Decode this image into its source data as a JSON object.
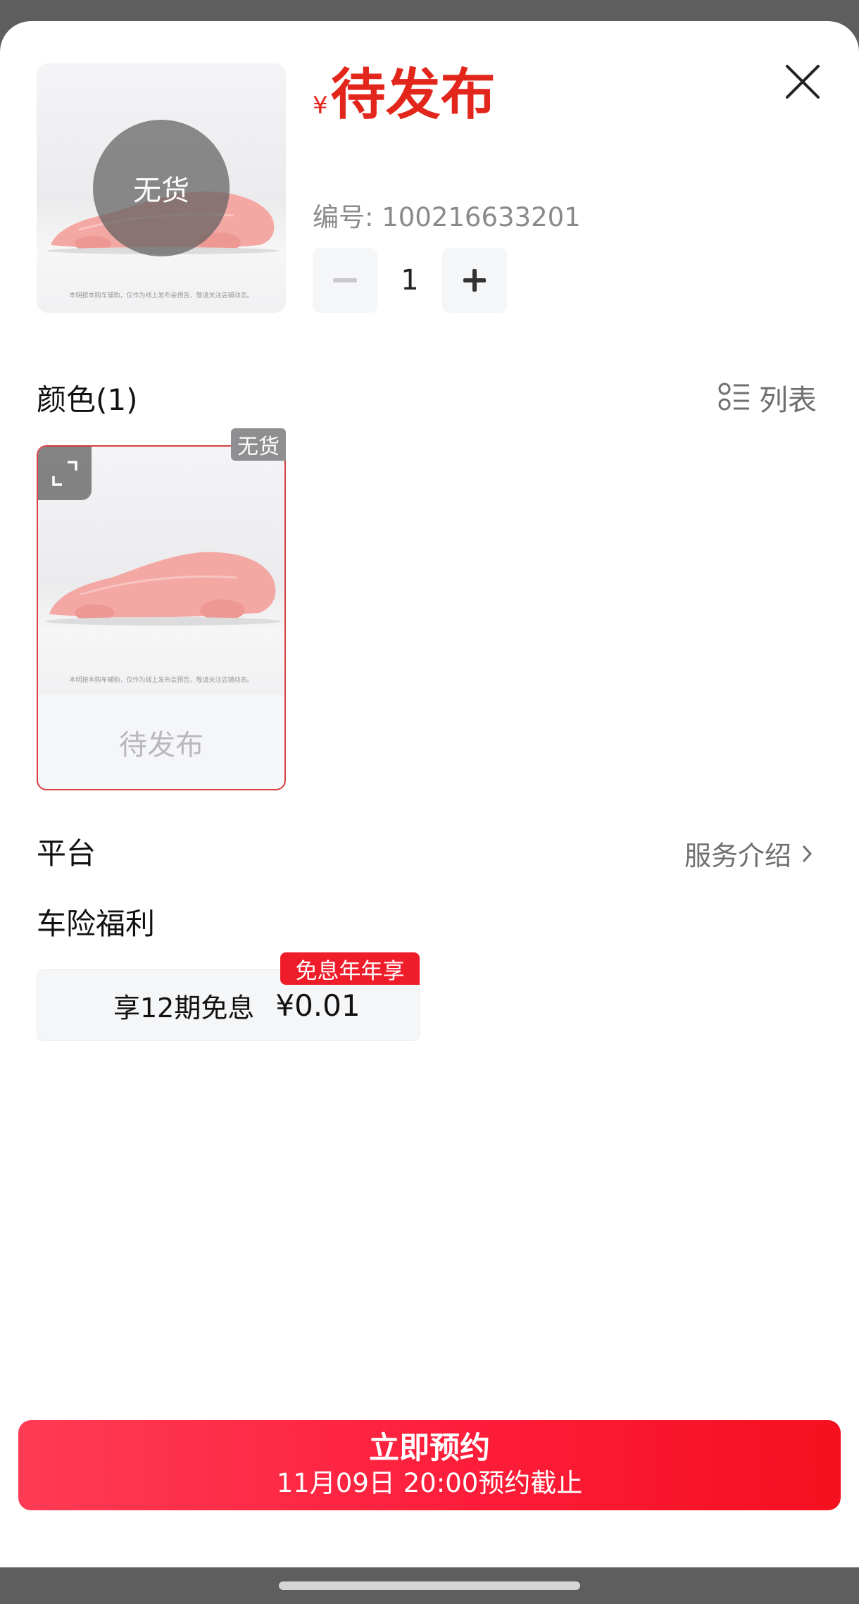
{
  "product": {
    "currency_symbol": "¥",
    "price_text": "待发布",
    "out_of_stock_label": "无货",
    "image_disclaimer": "本明按本购车辅助，仅作为线上发布会预告，敬请关注店铺动态。",
    "sku_label": "编号: 100216633201"
  },
  "quantity": {
    "value": "1",
    "minus_icon": "minus-icon",
    "plus_icon": "plus-icon"
  },
  "color_section": {
    "title": "颜色(1)",
    "list_toggle_label": "列表",
    "list_icon": "list-icon",
    "options": [
      {
        "name": "待发布",
        "tag": "无货",
        "image_disclaimer": "本明按本购车辅助，仅作为线上发布会预告，敬请关注店铺动态。"
      }
    ]
  },
  "platform_section": {
    "title": "平台",
    "service_link_label": "服务介绍"
  },
  "insurance_section": {
    "title": "车险福利",
    "benefit": {
      "text": "享12期免息",
      "price": "¥0.01",
      "tag": "免息年年享"
    }
  },
  "cta": {
    "main_label": "立即预约",
    "sub_label": "11月09日 20:00预约截止"
  },
  "colors": {
    "accent_red": "#e3261c",
    "cta_red": "#fd1d3a",
    "tag_red": "#ef1d2a",
    "selected_border": "#d94040"
  }
}
